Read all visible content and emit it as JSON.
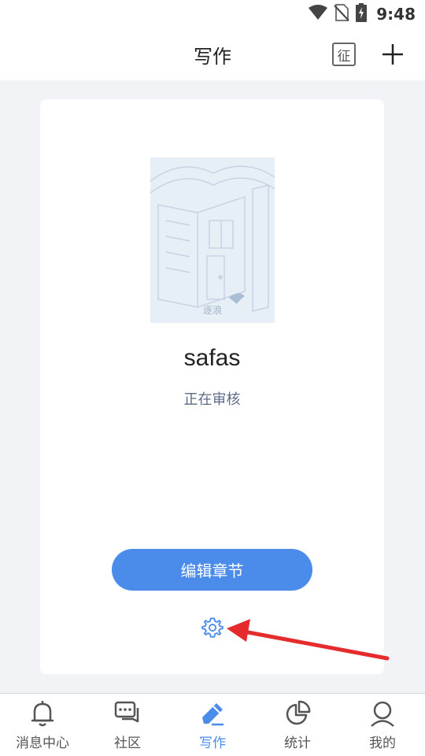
{
  "status_bar": {
    "time": "9:48"
  },
  "header": {
    "title": "写作",
    "contest_label": "征"
  },
  "book": {
    "title": "safas",
    "status": "正在审核",
    "cover_caption": "逐浪"
  },
  "actions": {
    "edit_label": "编辑章节"
  },
  "tabs": [
    {
      "label": "消息中心",
      "icon": "bell-icon",
      "active": false
    },
    {
      "label": "社区",
      "icon": "chat-icon",
      "active": false
    },
    {
      "label": "写作",
      "icon": "pen-icon",
      "active": true
    },
    {
      "label": "统计",
      "icon": "pie-chart-icon",
      "active": false
    },
    {
      "label": "我的",
      "icon": "user-icon",
      "active": false
    }
  ],
  "colors": {
    "accent": "#4b8be9",
    "annotation_arrow": "#e52b2b"
  }
}
